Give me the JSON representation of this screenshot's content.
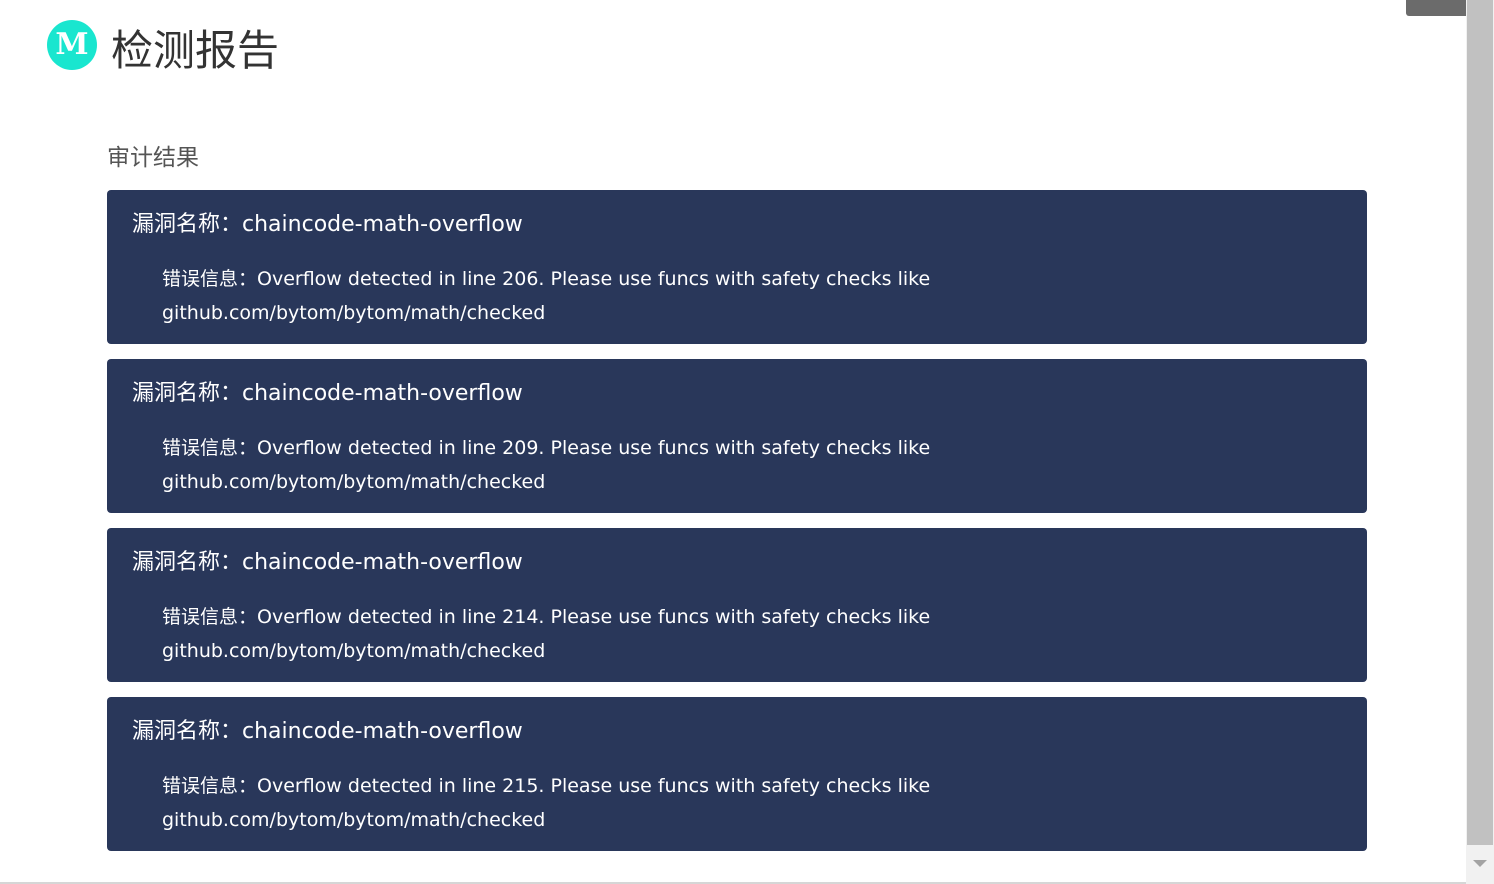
{
  "header": {
    "logo_letter": "M",
    "title": "检测报告"
  },
  "section": {
    "title": "审计结果"
  },
  "results": [
    {
      "name_label": "漏洞名称：",
      "name": "chaincode-math-overflow",
      "message_label": "错误信息：",
      "message": "Overflow detected in line 206. Please use funcs with safety checks like github.com/bytom/bytom/math/checked"
    },
    {
      "name_label": "漏洞名称：",
      "name": "chaincode-math-overflow",
      "message_label": "错误信息：",
      "message": "Overflow detected in line 209. Please use funcs with safety checks like github.com/bytom/bytom/math/checked"
    },
    {
      "name_label": "漏洞名称：",
      "name": "chaincode-math-overflow",
      "message_label": "错误信息：",
      "message": "Overflow detected in line 214. Please use funcs with safety checks like github.com/bytom/bytom/math/checked"
    },
    {
      "name_label": "漏洞名称：",
      "name": "chaincode-math-overflow",
      "message_label": "错误信息：",
      "message": "Overflow detected in line 215. Please use funcs with safety checks like github.com/bytom/bytom/math/checked"
    }
  ],
  "colors": {
    "logo": "#19e6cf",
    "card_background": "#29375a",
    "card_text": "#ffffff"
  }
}
